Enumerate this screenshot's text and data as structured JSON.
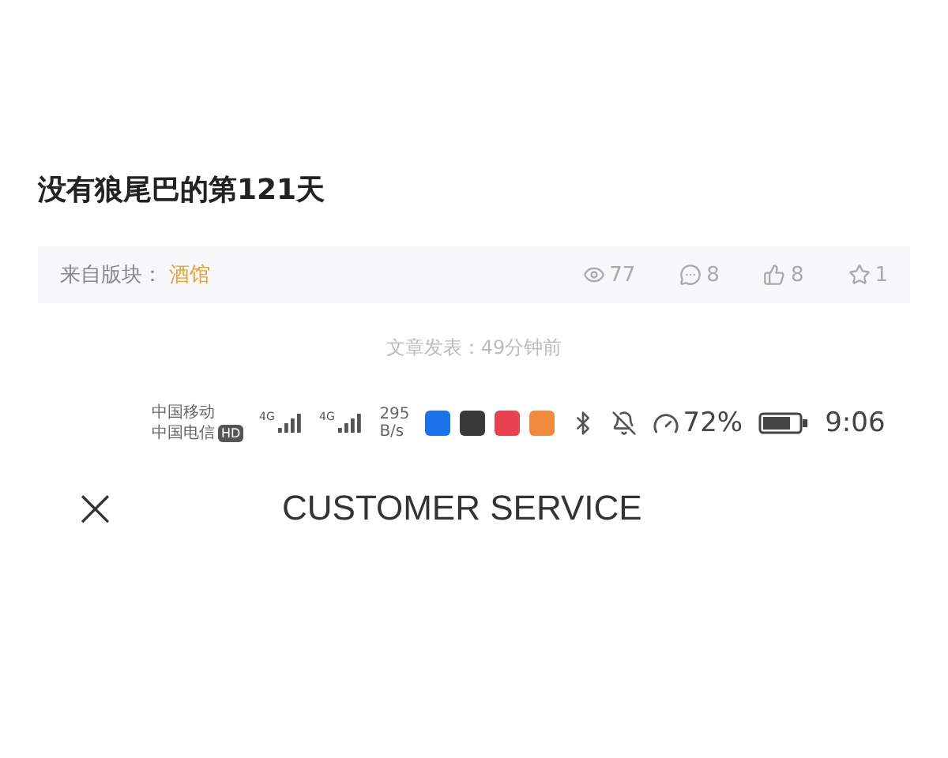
{
  "post": {
    "title": "没有狼尾巴的第121天"
  },
  "meta": {
    "board_label": "来自版块：",
    "board": "酒馆",
    "stats": [
      {
        "kind": "views",
        "value": "77"
      },
      {
        "kind": "comments",
        "value": "8"
      },
      {
        "kind": "likes",
        "value": "8"
      },
      {
        "kind": "favorites",
        "value": "1"
      }
    ]
  },
  "published": "文章发表：49分钟前",
  "status_bar": {
    "carriers": [
      "中国移动",
      "中国电信"
    ],
    "hd_badge": "HD",
    "signals": [
      "4G",
      "4G"
    ],
    "speed": [
      "295",
      "B/s"
    ],
    "apps": [
      {
        "color": "#1a73e8"
      },
      {
        "color": "#3a3a3a"
      },
      {
        "color": "#e8414f"
      },
      {
        "color": "#f08a3c"
      }
    ],
    "battery_percent": "72%",
    "time": "9:06"
  },
  "header": {
    "close": "×",
    "title": "CUSTOMER SERVICE"
  }
}
